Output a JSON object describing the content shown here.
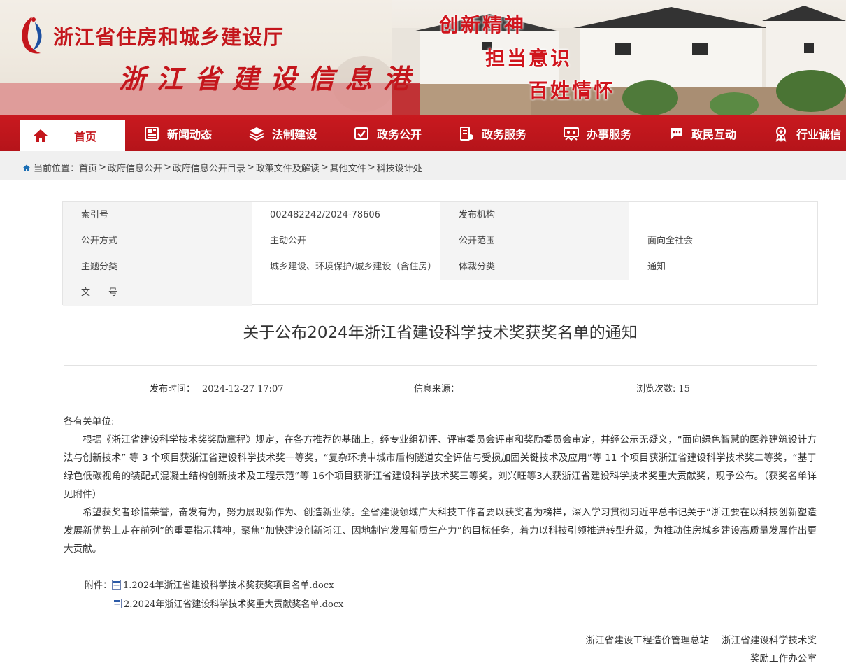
{
  "header": {
    "site_title": "浙江省住房和城乡建设厅",
    "site_subtitle": "浙江省建设信息港",
    "slogans": [
      "创新精神",
      "担当意识",
      "百姓情怀"
    ],
    "brand_color": "#c4161c"
  },
  "nav": {
    "items": [
      {
        "label": "首页",
        "icon": "home-icon"
      },
      {
        "label": "新闻动态",
        "icon": "newspaper-icon"
      },
      {
        "label": "法制建设",
        "icon": "layers-icon"
      },
      {
        "label": "政务公开",
        "icon": "checkbox-icon"
      },
      {
        "label": "政务服务",
        "icon": "service-icon"
      },
      {
        "label": "办事服务",
        "icon": "people-icon"
      },
      {
        "label": "政民互动",
        "icon": "chat-icon"
      },
      {
        "label": "行业诚信",
        "icon": "medal-icon"
      }
    ]
  },
  "breadcrumb": {
    "prefix": "当前位置：",
    "items": [
      "首页",
      "政府信息公开",
      "政府信息公开目录",
      "政策文件及解读",
      "其他文件",
      "科技设计处"
    ]
  },
  "meta": {
    "index_label": "索引号",
    "index_value": "002482242/2024-78606",
    "publisher_label": "发布机构",
    "publisher_value": "",
    "open_mode_label": "公开方式",
    "open_mode_value": "主动公开",
    "open_scope_label": "公开范围",
    "open_scope_value": "面向全社会",
    "topic_label": "主题分类",
    "topic_value": "城乡建设、环境保护/城乡建设（含住房）",
    "genre_label": "体裁分类",
    "genre_value": "通知",
    "doc_no_label": "文　　号",
    "doc_no_value": ""
  },
  "article": {
    "title": "关于公布2024年浙江省建设科学技术奖获奖名单的通知",
    "publish_time_label": "发布时间：",
    "publish_time": "2024-12-27 17:07",
    "source_label": "信息来源：",
    "source": "",
    "views_label": "浏览次数:",
    "views": "15",
    "salutation": "各有关单位:",
    "para1": "根据《浙江省建设科学技术奖奖励章程》规定，在各方推荐的基础上，经专业组初评、评审委员会评审和奖励委员会审定，并经公示无疑义，“面向绿色智慧的医养建筑设计方法与创新技术” 等 3 个项目获浙江省建设科学技术奖一等奖，“复杂环境中城市盾构隧道安全评估与受损加固关键技术及应用”等 11 个项目获浙江省建设科学技术奖二等奖，“基于绿色低碳视角的装配式混凝土结构创新技术及工程示范”等 16个项目获浙江省建设科学技术奖三等奖，刘兴旺等3人获浙江省建设科学技术奖重大贡献奖，现予公布。（获奖名单详见附件）",
    "para2": "希望获奖者珍惜荣誉，奋发有为，努力展现新作为、创造新业绩。全省建设领域广大科技工作者要以获奖者为榜样，深入学习贯彻习近平总书记关于“浙江要在以科技创新塑造发展新优势上走在前列”的重要指示精神，聚焦“加快建设创新浙江、因地制宜发展新质生产力”的目标任务，着力以科技引领推进转型升级，为推动住房城乡建设高质量发展作出更大贡献。",
    "attachments_label": "附件：",
    "attachments": [
      "1.2024年浙江省建设科学技术奖获奖项目名单.docx",
      "2.2024年浙江省建设科学技术奖重大贡献奖名单.docx"
    ],
    "signer_line1": "浙江省建设工程造价管理总站　 浙江省建设科学技术奖",
    "signer_line2": "奖励工作办公室"
  }
}
